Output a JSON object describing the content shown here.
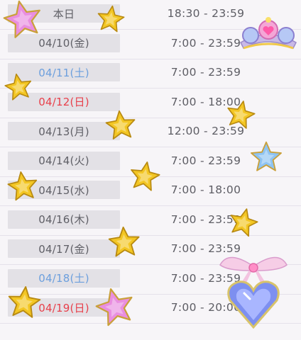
{
  "schedule": [
    {
      "date": "本日",
      "hours": "18:30 - 23:59",
      "day_type": "today"
    },
    {
      "date": "04/10(金)",
      "hours": "7:00 - 23:59",
      "day_type": "weekday"
    },
    {
      "date": "04/11(土)",
      "hours": "7:00 - 23:59",
      "day_type": "saturday"
    },
    {
      "date": "04/12(日)",
      "hours": "7:00 - 18:00",
      "day_type": "sunday"
    },
    {
      "date": "04/13(月)",
      "hours": "12:00 - 23:59",
      "day_type": "weekday"
    },
    {
      "date": "04/14(火)",
      "hours": "7:00 - 23:59",
      "day_type": "weekday"
    },
    {
      "date": "04/15(水)",
      "hours": "7:00 - 18:00",
      "day_type": "weekday"
    },
    {
      "date": "04/16(木)",
      "hours": "7:00 - 23:59",
      "day_type": "weekday"
    },
    {
      "date": "04/17(金)",
      "hours": "7:00 - 23:59",
      "day_type": "weekday"
    },
    {
      "date": "04/18(土)",
      "hours": "7:00 - 23:59",
      "day_type": "saturday"
    },
    {
      "date": "04/19(日)",
      "hours": "7:00 - 20:00",
      "day_type": "sunday"
    }
  ],
  "colors": {
    "weekday_text": "#5f5f66",
    "saturday_text": "#6c9fdd",
    "sunday_text": "#e8404b",
    "date_cell_bg": "#e3e1e6",
    "row_divider": "#e5e1ea",
    "gold_star": "#f3c623",
    "pink_star": "#e98ee0",
    "blue_star": "#8ec3f2"
  },
  "decorations": [
    "pink-star-icon",
    "gold-star-icon",
    "blue-star-icon",
    "tiara-icon",
    "heart-jewel-ribbon-icon"
  ]
}
